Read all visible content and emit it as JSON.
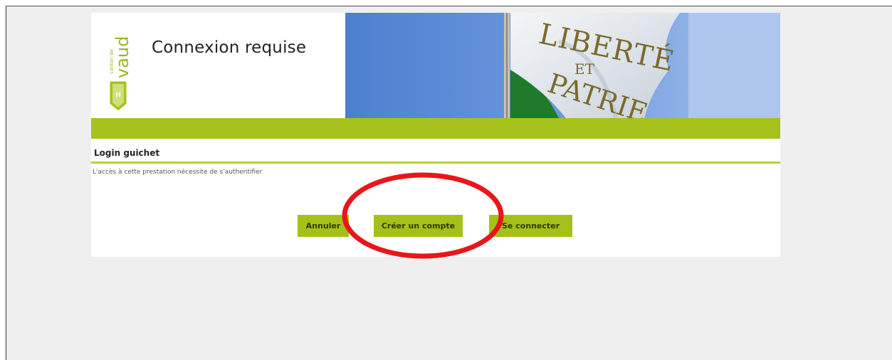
{
  "header": {
    "logo_text": "canton de vaud",
    "title": "Connexion requise",
    "flag_text_1": "LIBERTÉ",
    "flag_text_2": "ET",
    "flag_text_3": "PATRIE"
  },
  "section": {
    "title": "Login guichet",
    "description": "L'accès à cette prestation nécessite de s'authentifier"
  },
  "buttons": {
    "cancel": "Annuler",
    "create_account": "Créer un compte",
    "connect": "Se connecter"
  },
  "colors": {
    "accent_green": "#a7c21b",
    "annotation_red": "#e8161b",
    "page_bg": "#efefef"
  },
  "icons": [
    "vaud-shield-logo",
    "flag-banner"
  ]
}
